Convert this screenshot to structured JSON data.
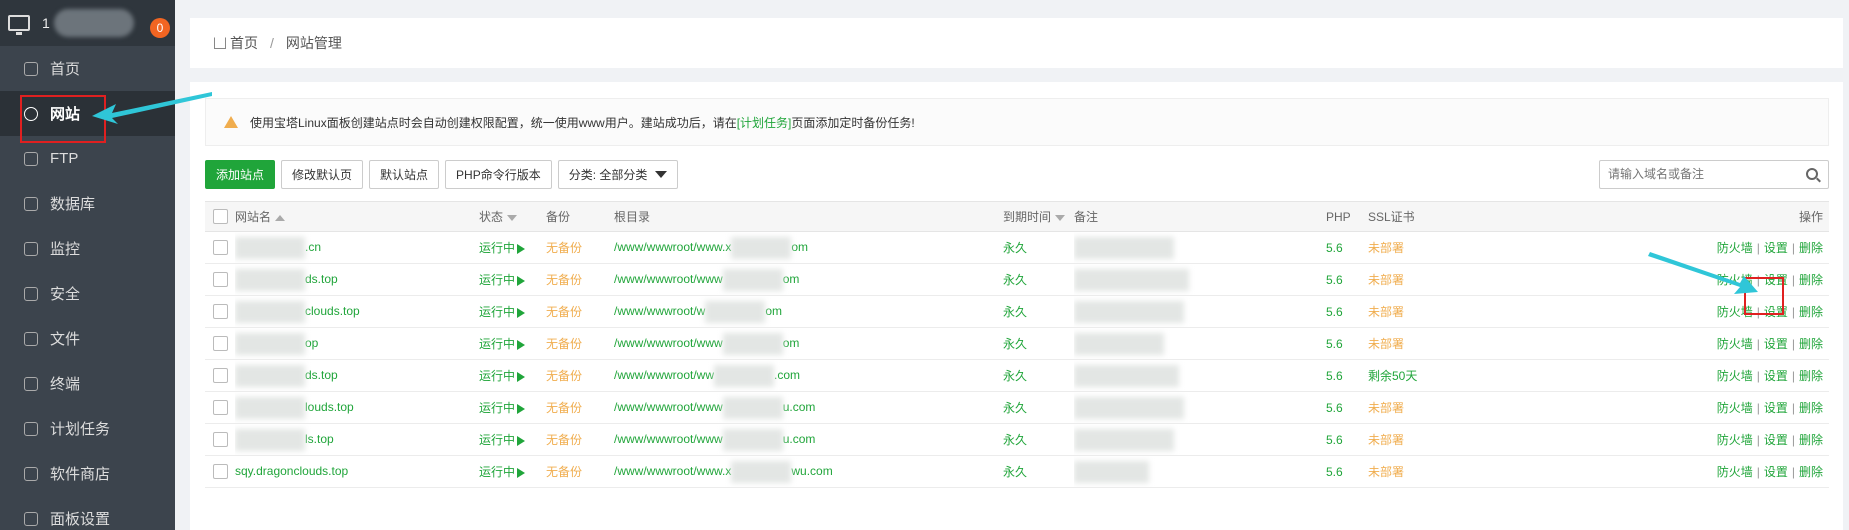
{
  "sidebar": {
    "host_prefix": "1",
    "notification_count": "0",
    "items": [
      {
        "label": "首页",
        "icon": "home-icon"
      },
      {
        "label": "网站",
        "icon": "globe-icon",
        "active": true
      },
      {
        "label": "FTP",
        "icon": "ftp-icon"
      },
      {
        "label": "数据库",
        "icon": "database-icon"
      },
      {
        "label": "监控",
        "icon": "monitor-icon"
      },
      {
        "label": "安全",
        "icon": "shield-icon"
      },
      {
        "label": "文件",
        "icon": "folder-icon"
      },
      {
        "label": "终端",
        "icon": "terminal-icon"
      },
      {
        "label": "计划任务",
        "icon": "calendar-icon"
      },
      {
        "label": "软件商店",
        "icon": "grid-icon"
      },
      {
        "label": "面板设置",
        "icon": "gear-icon"
      }
    ]
  },
  "breadcrumb": {
    "home": "首页",
    "current": "网站管理"
  },
  "notice": {
    "text_before": "使用宝塔Linux面板创建站点时会自动创建权限配置，统一使用www用户。建站成功后，请在",
    "link": "[计划任务]",
    "text_after": "页面添加定时备份任务!"
  },
  "toolbar": {
    "add_site": "添加站点",
    "edit_default_page": "修改默认页",
    "default_site": "默认站点",
    "php_cli_version": "PHP命令行版本",
    "category": "分类: 全部分类",
    "search_placeholder": "请输入域名或备注"
  },
  "table": {
    "headers": {
      "name": "网站名",
      "status": "状态",
      "backup": "备份",
      "root": "根目录",
      "expire": "到期时间",
      "note": "备注",
      "php": "PHP",
      "ssl": "SSL证书",
      "ops": "操作"
    },
    "rows": [
      {
        "name": ".cn",
        "status": "运行中",
        "backup": "无备份",
        "root_pre": "/www/wwwroot/www.x",
        "root_post": "om",
        "expire": "永久",
        "php": "5.6",
        "ssl": "未部署",
        "ssl_status": "orange"
      },
      {
        "name": "ds.top",
        "status": "运行中",
        "backup": "无备份",
        "root_pre": "/www/wwwroot/www",
        "root_post": "om",
        "expire": "永久",
        "php": "5.6",
        "ssl": "未部署",
        "ssl_status": "orange"
      },
      {
        "name": "clouds.top",
        "status": "运行中",
        "backup": "无备份",
        "root_pre": "/www/wwwroot/w",
        "root_post": "om",
        "expire": "永久",
        "php": "5.6",
        "ssl": "未部署",
        "ssl_status": "orange"
      },
      {
        "name": "op",
        "status": "运行中",
        "backup": "无备份",
        "root_pre": "/www/wwwroot/www",
        "root_post": "om",
        "expire": "永久",
        "php": "5.6",
        "ssl": "未部署",
        "ssl_status": "orange"
      },
      {
        "name": "ds.top",
        "status": "运行中",
        "backup": "无备份",
        "root_pre": "/www/wwwroot/ww",
        "root_post": ".com",
        "expire": "永久",
        "php": "5.6",
        "ssl": "剩余50天",
        "ssl_status": "green"
      },
      {
        "name": "louds.top",
        "status": "运行中",
        "backup": "无备份",
        "root_pre": "/www/wwwroot/www",
        "root_post": "u.com",
        "expire": "永久",
        "php": "5.6",
        "ssl": "未部署",
        "ssl_status": "orange"
      },
      {
        "name": "ls.top",
        "status": "运行中",
        "backup": "无备份",
        "root_pre": "/www/wwwroot/www",
        "root_post": "u.com",
        "expire": "永久",
        "php": "5.6",
        "ssl": "未部署",
        "ssl_status": "orange"
      },
      {
        "name": "sqy.dragonclouds.top",
        "status": "运行中",
        "backup": "无备份",
        "root_pre": "/www/wwwroot/www.x",
        "root_post": "wu.com",
        "expire": "永久",
        "php": "5.6",
        "ssl": "未部署",
        "ssl_status": "orange"
      }
    ],
    "op_firewall": "防火墙",
    "op_settings": "设置",
    "op_delete": "删除"
  },
  "colors": {
    "accent": "#20a53a",
    "warning": "#f0ad4e",
    "sidebar": "#3c444d",
    "annotation_red": "#e02020",
    "annotation_arrow": "#2fc6d8"
  }
}
